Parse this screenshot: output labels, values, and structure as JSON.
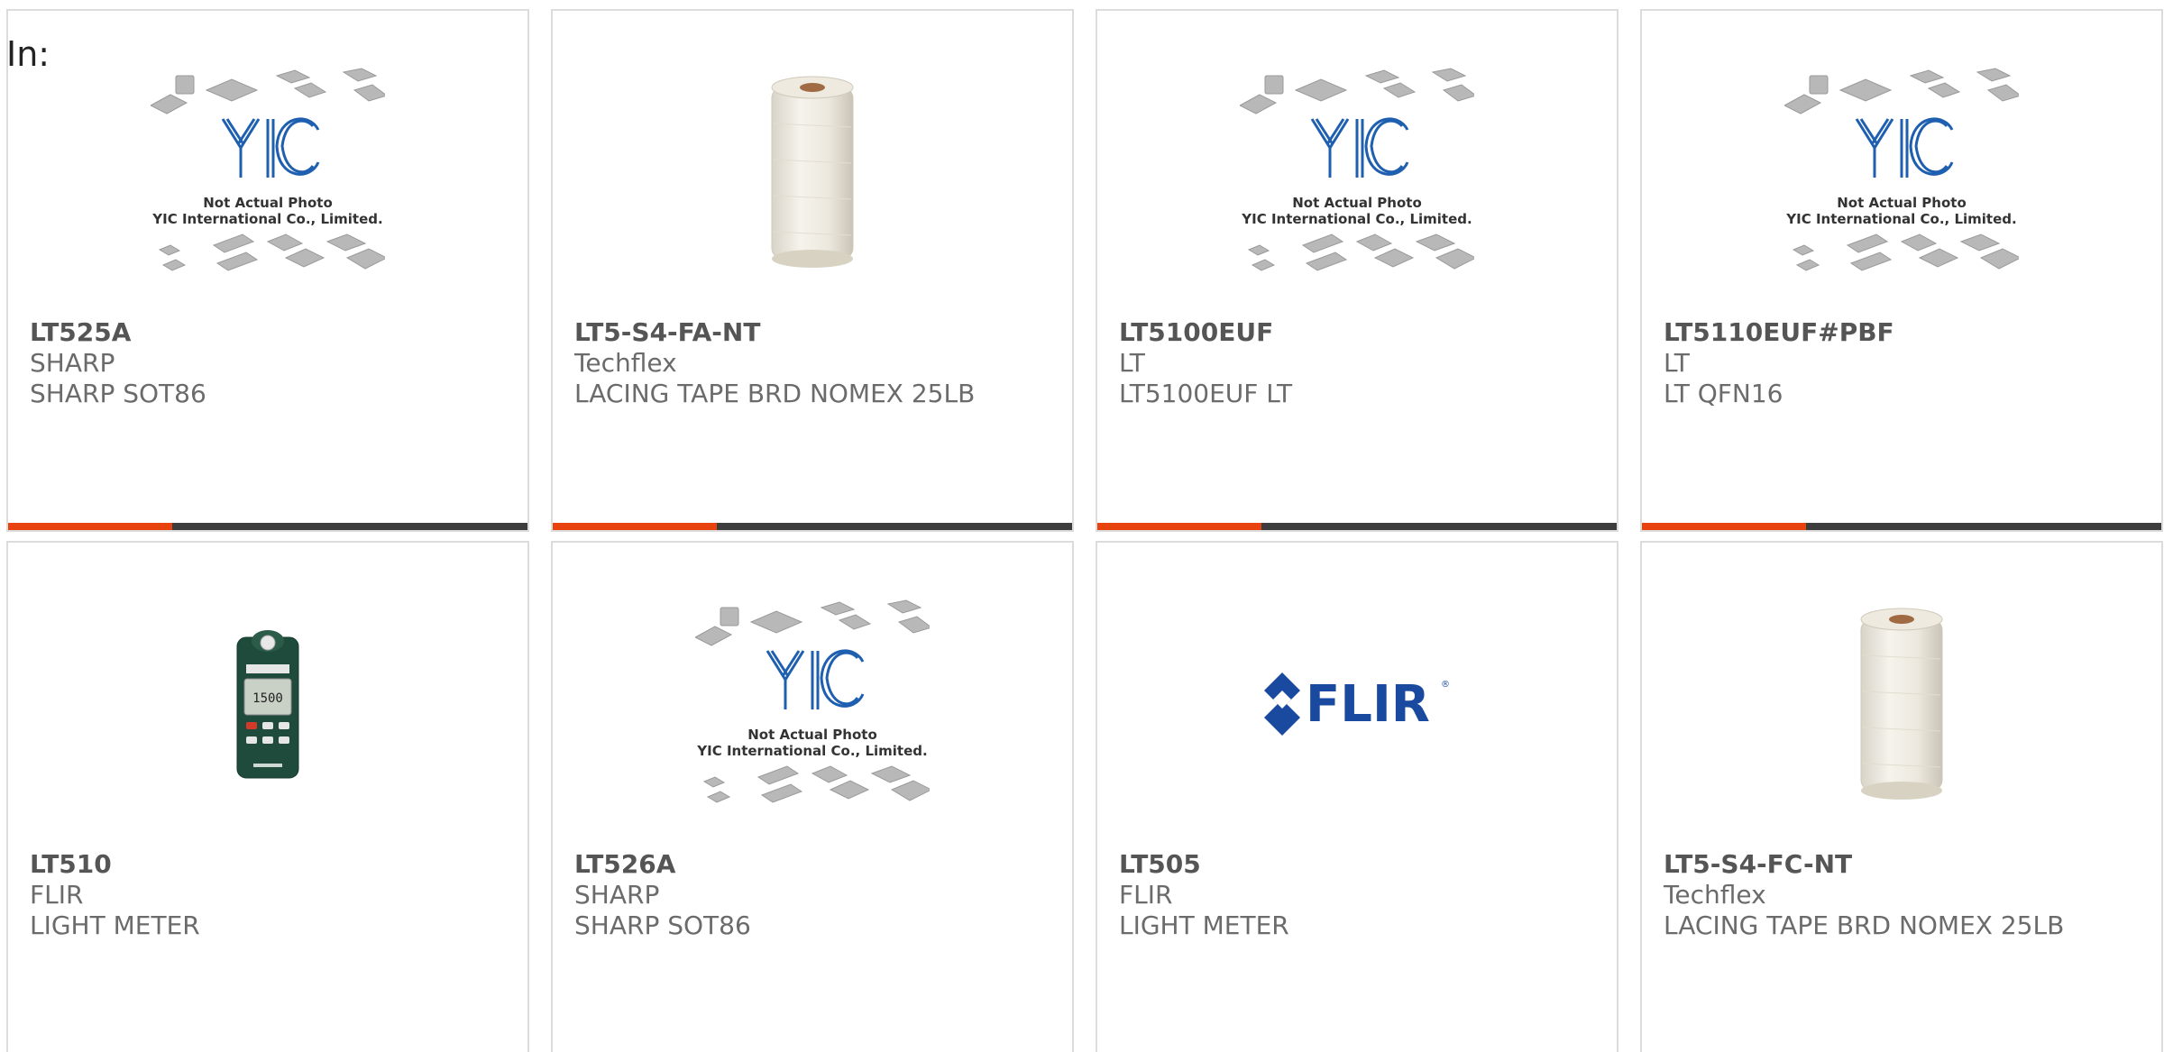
{
  "header": {
    "in_label": "In:"
  },
  "colors": {
    "accent_bar": "#e8430f",
    "dark_bar": "#3d3d3d",
    "yic_blue": "#1f5fb0",
    "flir_blue": "#1a4aa0"
  },
  "placeholder": {
    "line1": "Not Actual Photo",
    "line2": "YIC International Co., Limited."
  },
  "flir_logo_text": "FLIR",
  "products": [
    {
      "part_number": "LT525A",
      "manufacturer": "SHARP",
      "description": "SHARP SOT86",
      "image": "placeholder-photo"
    },
    {
      "part_number": "LT5-S4-FA-NT",
      "manufacturer": "Techflex",
      "description": "LACING TAPE BRD NOMEX 25LB",
      "image": "tape-spool-photo"
    },
    {
      "part_number": "LT5100EUF",
      "manufacturer": "LT",
      "description": "LT5100EUF LT",
      "image": "placeholder-photo"
    },
    {
      "part_number": "LT5110EUF#PBF",
      "manufacturer": "LT",
      "description": "LT QFN16",
      "image": "placeholder-photo"
    },
    {
      "part_number": "LT510",
      "manufacturer": "FLIR",
      "description": "LIGHT METER",
      "image": "light-meter-photo"
    },
    {
      "part_number": "LT526A",
      "manufacturer": "SHARP",
      "description": "SHARP SOT86",
      "image": "placeholder-photo"
    },
    {
      "part_number": "LT505",
      "manufacturer": "FLIR",
      "description": "LIGHT METER",
      "image": "flir-logo"
    },
    {
      "part_number": "LT5-S4-FC-NT",
      "manufacturer": "Techflex",
      "description": "LACING TAPE BRD NOMEX 25LB",
      "image": "tape-spool-photo"
    }
  ]
}
